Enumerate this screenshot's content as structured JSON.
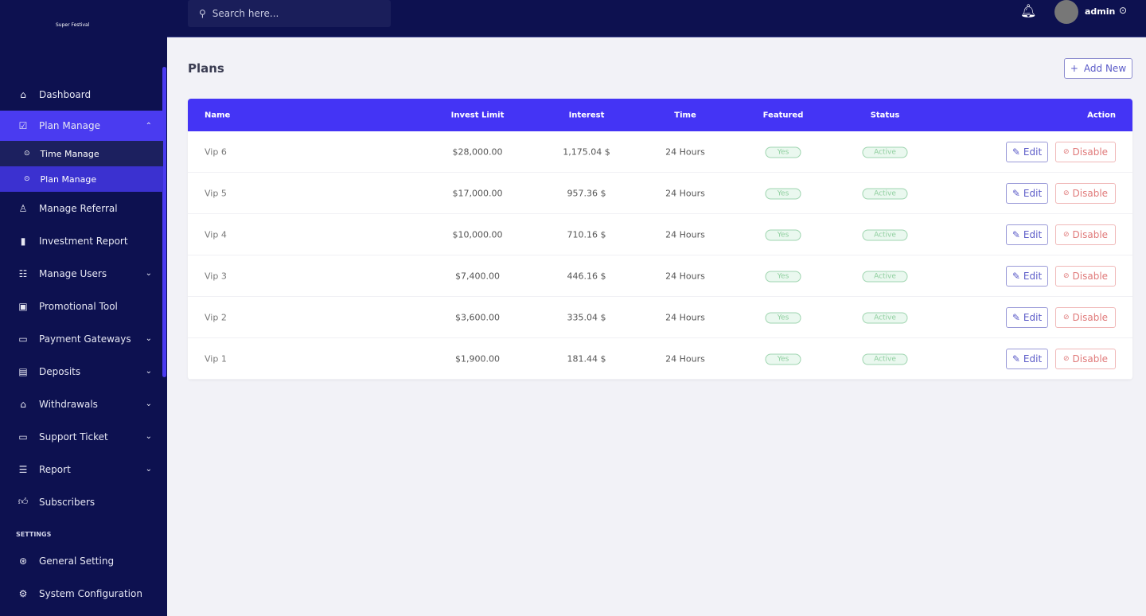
{
  "brand": {
    "name": "Super Festival"
  },
  "search": {
    "placeholder": "Search here..."
  },
  "user": {
    "name": "admin"
  },
  "sidebar": {
    "items": [
      {
        "label": "Dashboard",
        "icon": "home-icon"
      },
      {
        "label": "Plan Manage",
        "icon": "clipboard-icon",
        "active": true,
        "sub": [
          {
            "label": "Time Manage"
          },
          {
            "label": "Plan Manage"
          }
        ]
      },
      {
        "label": "Manage Referral",
        "icon": "referral-icon"
      },
      {
        "label": "Investment Report",
        "icon": "bar-chart-icon"
      },
      {
        "label": "Manage Users",
        "icon": "users-icon",
        "chevron": true
      },
      {
        "label": "Promotional Tool",
        "icon": "promo-icon"
      },
      {
        "label": "Payment Gateways",
        "icon": "card-icon",
        "chevron": true
      },
      {
        "label": "Deposits",
        "icon": "deposit-icon",
        "chevron": true
      },
      {
        "label": "Withdrawals",
        "icon": "bank-icon",
        "chevron": true
      },
      {
        "label": "Support Ticket",
        "icon": "ticket-icon",
        "chevron": true
      },
      {
        "label": "Report",
        "icon": "list-icon",
        "chevron": true
      },
      {
        "label": "Subscribers",
        "icon": "thumbs-up-icon"
      }
    ],
    "settings_label": "SETTINGS",
    "settings": [
      {
        "label": "General Setting",
        "icon": "settings-icon"
      },
      {
        "label": "System Configuration",
        "icon": "gear-icon"
      }
    ]
  },
  "page": {
    "title": "Plans",
    "add_label": "Add New"
  },
  "table": {
    "headers": {
      "name": "Name",
      "invest": "Invest Limit",
      "interest": "Interest",
      "time": "Time",
      "featured": "Featured",
      "status": "Status",
      "action": "Action"
    },
    "edit_label": "Edit",
    "disable_label": "Disable",
    "rows": [
      {
        "name": "Vip 6",
        "invest": "$28,000.00",
        "interest": "1,175.04 $",
        "time": "24 Hours",
        "featured": "Yes",
        "status": "Active"
      },
      {
        "name": "Vip 5",
        "invest": "$17,000.00",
        "interest": "957.36 $",
        "time": "24 Hours",
        "featured": "Yes",
        "status": "Active"
      },
      {
        "name": "Vip 4",
        "invest": "$10,000.00",
        "interest": "710.16 $",
        "time": "24 Hours",
        "featured": "Yes",
        "status": "Active"
      },
      {
        "name": "Vip 3",
        "invest": "$7,400.00",
        "interest": "446.16 $",
        "time": "24 Hours",
        "featured": "Yes",
        "status": "Active"
      },
      {
        "name": "Vip 2",
        "invest": "$3,600.00",
        "interest": "335.04 $",
        "time": "24 Hours",
        "featured": "Yes",
        "status": "Active"
      },
      {
        "name": "Vip 1",
        "invest": "$1,900.00",
        "interest": "181.44 $",
        "time": "24 Hours",
        "featured": "Yes",
        "status": "Active"
      }
    ]
  }
}
